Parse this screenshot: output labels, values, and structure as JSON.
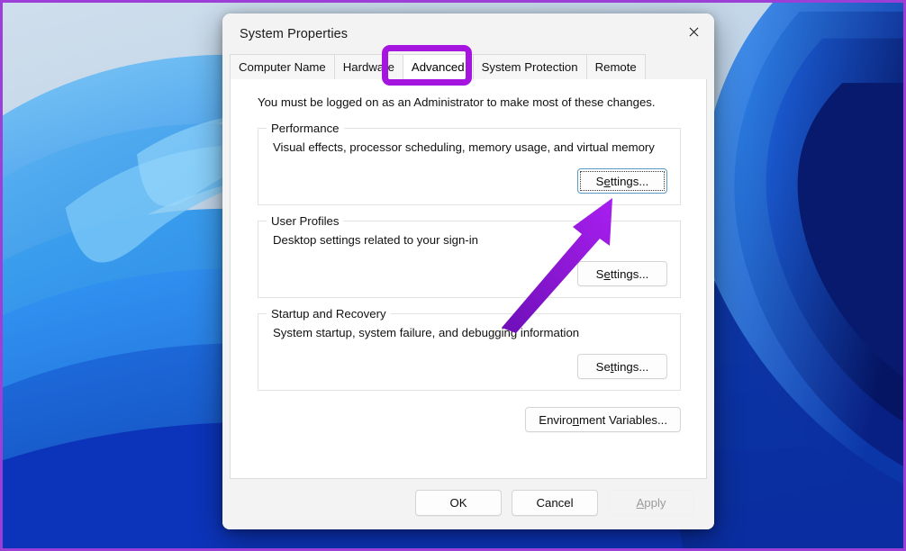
{
  "window": {
    "title": "System Properties",
    "close_icon": "close-icon"
  },
  "tabs": [
    {
      "label": "Computer Name",
      "active": false
    },
    {
      "label": "Hardware",
      "active": false
    },
    {
      "label": "Advanced",
      "active": true
    },
    {
      "label": "System Protection",
      "active": false
    },
    {
      "label": "Remote",
      "active": false
    }
  ],
  "page": {
    "intro": "You must be logged on as an Administrator to make most of these changes.",
    "groups": [
      {
        "legend": "Performance",
        "description": "Visual effects, processor scheduling, memory usage, and virtual memory",
        "button": {
          "prefix": "S",
          "accel": "e",
          "suffix": "ttings...",
          "focused": true
        }
      },
      {
        "legend": "User Profiles",
        "description": "Desktop settings related to your sign-in",
        "button": {
          "prefix": "S",
          "accel": "e",
          "suffix": "ttings...",
          "focused": false
        }
      },
      {
        "legend": "Startup and Recovery",
        "description": "System startup, system failure, and debugging information",
        "button": {
          "prefix": "Se",
          "accel": "t",
          "suffix": "tings...",
          "focused": false
        }
      }
    ],
    "environment_button": {
      "prefix": "Enviro",
      "accel": "n",
      "suffix": "ment Variables..."
    }
  },
  "footer": {
    "ok": "OK",
    "cancel": "Cancel",
    "apply": {
      "prefix": "",
      "accel": "A",
      "suffix": "pply",
      "disabled": true
    }
  },
  "annotations": {
    "tab_highlight_color": "#a614df",
    "arrow_color_light": "#a81ff0",
    "arrow_color_dark": "#6d0fb8",
    "border_color": "#9b3fd6"
  }
}
